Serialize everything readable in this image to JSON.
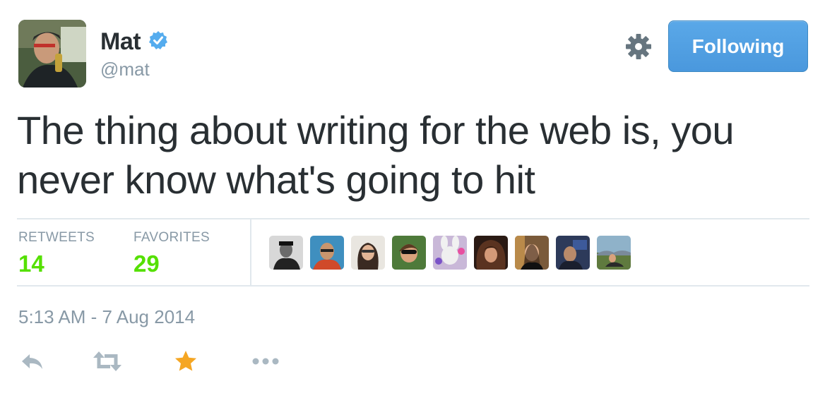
{
  "user": {
    "name": "Mat",
    "handle": "@mat",
    "follow_label": "Following"
  },
  "tweet": {
    "text": "The thing about writing for the web is, you never know what's going to hit",
    "timestamp": "5:13 AM - 7 Aug 2014"
  },
  "stats": {
    "retweets_label": "RETWEETS",
    "retweets_count": "14",
    "favorites_label": "FAVORITES",
    "favorites_count": "29"
  },
  "colors": {
    "follow_button": "#4a98dd",
    "stat_value": "#55e000",
    "favorited_star": "#f5a623",
    "muted": "#8899a6"
  },
  "icons": [
    "verified-badge-icon",
    "gear-icon",
    "reply-icon",
    "retweet-icon",
    "favorite-star-icon",
    "more-icon"
  ]
}
